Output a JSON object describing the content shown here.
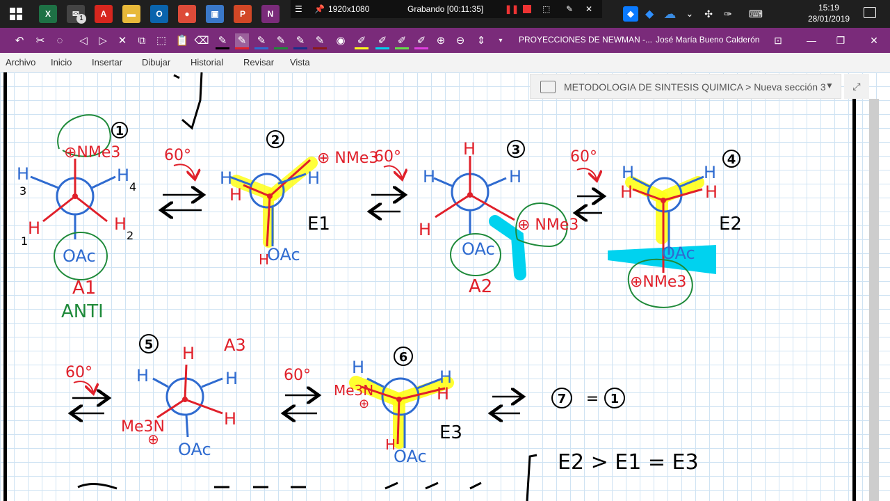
{
  "taskbar": {
    "apps": [
      {
        "icon": "excel-icon",
        "label": "X",
        "color": "#1e7145"
      },
      {
        "icon": "mail-icon",
        "label": "✉",
        "color": "#444444"
      },
      {
        "icon": "acrobat-icon",
        "label": "A",
        "color": "#d7261e"
      },
      {
        "icon": "folder-icon",
        "label": "▬",
        "color": "#e8b93a"
      },
      {
        "icon": "outlook-icon",
        "label": "O",
        "color": "#0a64ad"
      },
      {
        "icon": "chrome-icon",
        "label": "●",
        "color": "#dd4b39"
      },
      {
        "icon": "photos-icon",
        "label": "▣",
        "color": "#3a78c9"
      },
      {
        "icon": "powerpoint-icon",
        "label": "P",
        "color": "#d24726"
      },
      {
        "icon": "onenote-icon",
        "label": "N",
        "color": "#7a2b7a"
      }
    ],
    "mail_badge": "1",
    "resolution": "1920x1080",
    "recording": "Grabando [00:11:35]",
    "time": "15:19",
    "date": "28/01/2019"
  },
  "ribbon": {
    "title": "PROYECCIONES DE NEWMAN -...",
    "user": "José María Bueno Calderón"
  },
  "menu": [
    "Archivo",
    "Inicio",
    "Insertar",
    "Dibujar",
    "Historial",
    "Revisar",
    "Vista"
  ],
  "notebook": {
    "breadcrumb": "METODOLOGIA DE SINTESIS QUIMICA > Nueva sección 3"
  },
  "colors": {
    "accent": "#7a2b7a",
    "ink_red": "#e0202a",
    "ink_blue": "#2f6bd0",
    "ink_green": "#1f8a3a",
    "highlight_yellow": "#ffff1a",
    "highlight_cyan": "#00d2ef"
  },
  "ink": {
    "s1": {
      "num": "1",
      "group": "⊕NMe3",
      "h_left": "H",
      "h_right": "H",
      "h_bottom_left": "H",
      "h_bottom_right": "H",
      "n3": "3",
      "n4": "4",
      "n1": "1",
      "n2": "2",
      "oac": "OAc",
      "label": "A1",
      "sub": "ANTI"
    },
    "arrow1": "60°",
    "s2": {
      "num": "2",
      "group": "⊕ NMe3",
      "h1": "H",
      "h2": "H",
      "h3": "H",
      "h4": "H",
      "oac": "OAc",
      "label": "E1"
    },
    "arrow2": "60°",
    "s3": {
      "num": "3",
      "h_top": "H",
      "h_left": "H",
      "h_right": "H",
      "h_bottom": "H",
      "group": "⊕ NMe3",
      "oac": "OAc",
      "label": "A2"
    },
    "arrow3": "60°",
    "s4": {
      "num": "4",
      "h1": "H",
      "h2": "H",
      "h3": "H",
      "h4": "H",
      "oac": "OAc",
      "group": "⊕NMe3",
      "label": "E2"
    },
    "arrow4": "60°",
    "s5": {
      "num": "5",
      "h_top": "H",
      "h_left": "H",
      "h_right": "H",
      "h_bottom_right": "H",
      "group": "Me3N",
      "plus": "⊕",
      "oac": "OAc",
      "label": "A3"
    },
    "arrow5": "60°",
    "s6": {
      "num": "6",
      "h1": "H",
      "h2": "H",
      "h3": "H",
      "h4": "H",
      "group": "Me3N",
      "plus": "⊕",
      "oac": "OAc",
      "label": "E3"
    },
    "eq": {
      "left": "7",
      "sign": "=",
      "right": "1"
    },
    "ineq": "E2 > E1 = E3"
  }
}
